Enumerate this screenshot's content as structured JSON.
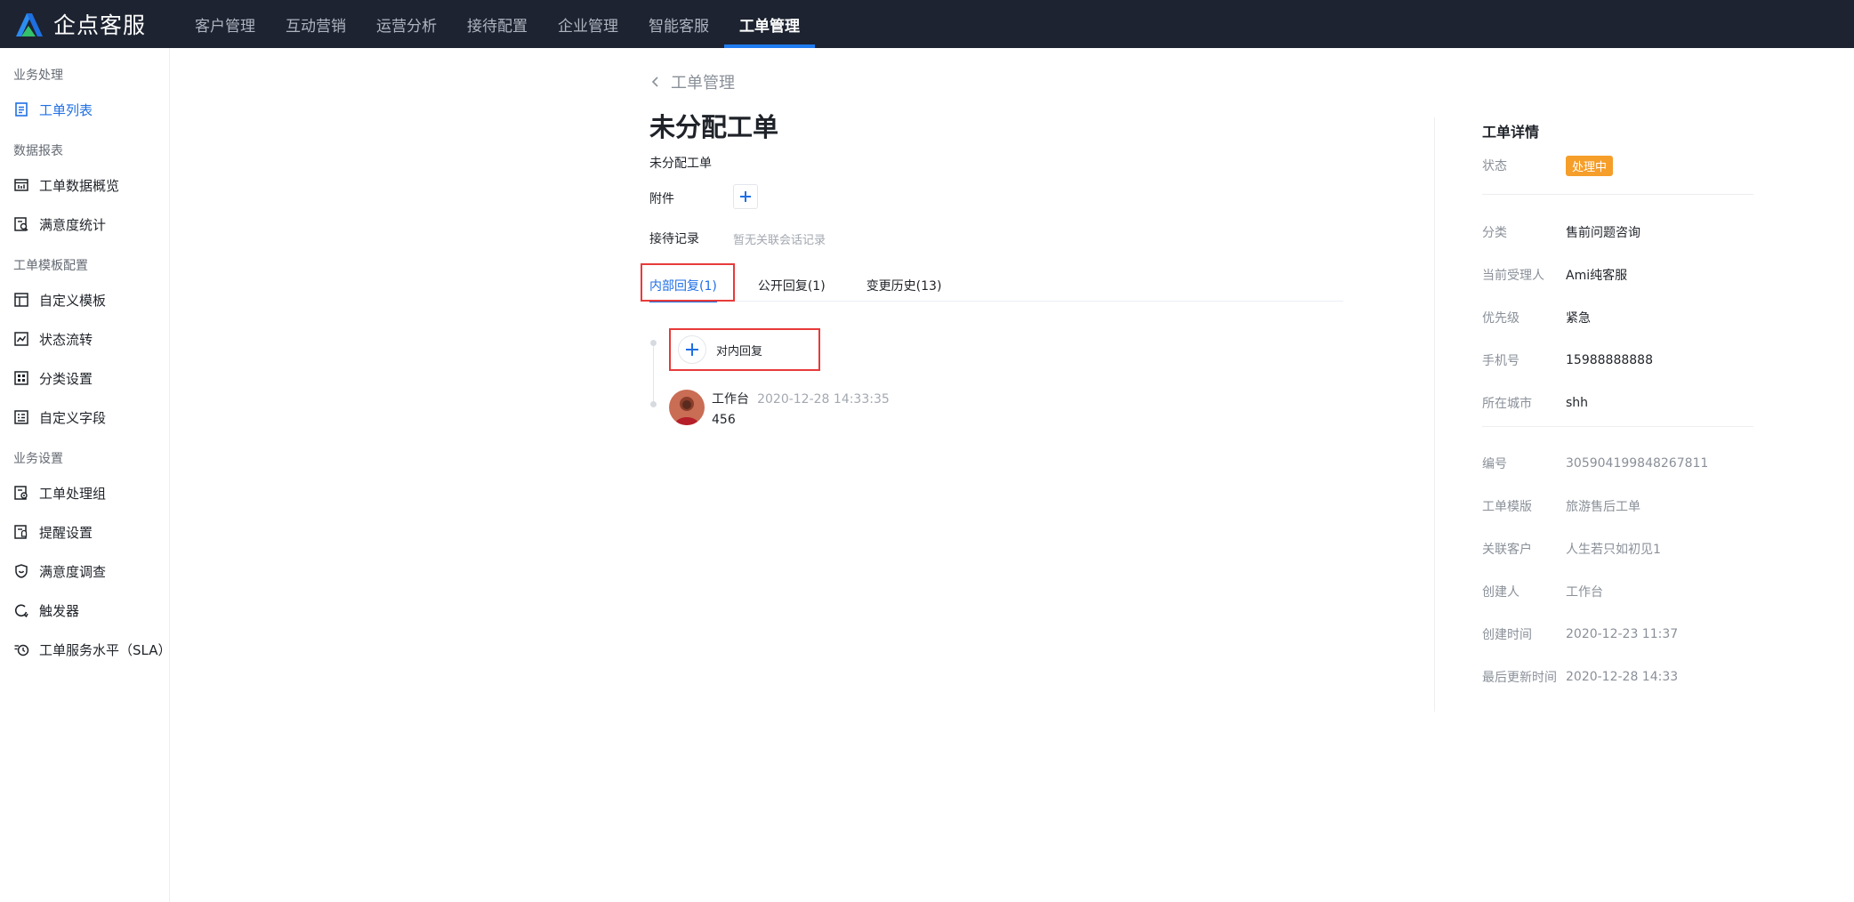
{
  "brand": {
    "name": "企点客服"
  },
  "topnav": [
    {
      "label": "客户管理",
      "active": false
    },
    {
      "label": "互动营销",
      "active": false
    },
    {
      "label": "运营分析",
      "active": false
    },
    {
      "label": "接待配置",
      "active": false
    },
    {
      "label": "企业管理",
      "active": false
    },
    {
      "label": "智能客服",
      "active": false
    },
    {
      "label": "工单管理",
      "active": true
    }
  ],
  "sidebar": {
    "groups": [
      {
        "title": "业务处理",
        "items": [
          {
            "label": "工单列表",
            "icon": "list-doc-icon",
            "active": true
          }
        ]
      },
      {
        "title": "数据报表",
        "items": [
          {
            "label": "工单数据概览",
            "icon": "chart-board-icon"
          },
          {
            "label": "满意度统计",
            "icon": "satisfaction-stats-icon"
          }
        ]
      },
      {
        "title": "工单模板配置",
        "items": [
          {
            "label": "自定义模板",
            "icon": "template-icon"
          },
          {
            "label": "状态流转",
            "icon": "flow-chart-icon"
          },
          {
            "label": "分类设置",
            "icon": "category-icon"
          },
          {
            "label": "自定义字段",
            "icon": "field-icon"
          }
        ]
      },
      {
        "title": "业务设置",
        "items": [
          {
            "label": "工单处理组",
            "icon": "group-settings-icon"
          },
          {
            "label": "提醒设置",
            "icon": "reminder-icon"
          },
          {
            "label": "满意度调查",
            "icon": "survey-icon"
          },
          {
            "label": "触发器",
            "icon": "trigger-icon"
          },
          {
            "label": "工单服务水平（SLA）",
            "icon": "sla-clock-icon"
          }
        ]
      }
    ]
  },
  "main": {
    "back_label": "工单管理",
    "title": "未分配工单",
    "subtitle": "未分配工单",
    "attachment_label": "附件",
    "reception_label": "接待记录",
    "reception_empty": "暂无关联会话记录",
    "tabs": [
      {
        "label": "内部回复(1)",
        "active": true
      },
      {
        "label": "公开回复(1)",
        "active": false
      },
      {
        "label": "变更历史(13)",
        "active": false
      }
    ],
    "reply_button_label": "对内回复",
    "comment": {
      "author": "工作台",
      "time": "2020-12-28 14:33:35",
      "text": "456"
    }
  },
  "detail": {
    "title": "工单详情",
    "status_label": "状态",
    "status_value": "处理中",
    "status_color": "#f59e2a",
    "section1": [
      {
        "k": "分类",
        "v": "售前问题咨询"
      },
      {
        "k": "当前受理人",
        "v": "Ami纯客服"
      },
      {
        "k": "优先级",
        "v": "紧急"
      },
      {
        "k": "手机号",
        "v": "15988888888"
      },
      {
        "k": "所在城市",
        "v": "shh"
      }
    ],
    "section2": [
      {
        "k": "编号",
        "v": "305904199848267811"
      },
      {
        "k": "工单模版",
        "v": "旅游售后工单"
      },
      {
        "k": "关联客户",
        "v": "人生若只如初见1"
      },
      {
        "k": "创建人",
        "v": "工作台"
      },
      {
        "k": "创建时间",
        "v": "2020-12-23 11:37"
      },
      {
        "k": "最后更新时间",
        "v": "2020-12-28 14:33"
      }
    ]
  },
  "colors": {
    "accent": "#1f6fe5",
    "topbar": "#1d2331",
    "highlight": "#e83a3a"
  }
}
